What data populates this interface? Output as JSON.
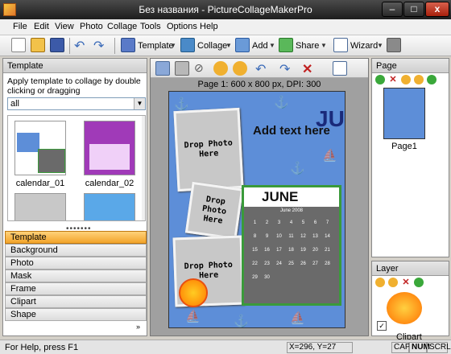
{
  "window": {
    "title": "Без названия - PictureCollageMakerPro"
  },
  "menu": [
    "File",
    "Edit",
    "View",
    "Photo",
    "Collage",
    "Tools",
    "Options",
    "Help"
  ],
  "toolbar": {
    "template": "Template",
    "collage": "Collage",
    "add": "Add",
    "share": "Share",
    "wizard": "Wizard"
  },
  "left": {
    "header": "Template",
    "description": "Apply template to collage by double clicking or dragging",
    "filter": "all",
    "thumbs": [
      "calendar_01",
      "calendar_02"
    ],
    "tabs": [
      "Template",
      "Background",
      "Photo",
      "Mask",
      "Frame",
      "Clipart",
      "Shape"
    ],
    "active_tab": "Template"
  },
  "center": {
    "pageinfo": "Page 1: 600 x 800 px, DPI: 300",
    "placeholder1": "Drop Photo Here",
    "placeholder2": "Drop Photo Here",
    "placeholder3": "Drop Photo Here",
    "addtext": "Add text here",
    "jun": "JUN",
    "cal_month": "JUNE",
    "cal_year": "June 2008"
  },
  "right": {
    "page_header": "Page",
    "page_label": "Page1",
    "layer_header": "Layer",
    "layer_item": "Clipart"
  },
  "status": {
    "help": "For Help, press F1",
    "coords": "X=296, Y=27",
    "cap": "CAP",
    "num": "NUM",
    "scrl": "SCRL"
  },
  "colors": {
    "accent_tab": "#f2a32a",
    "page_bg": "#5d8ed8",
    "calendar_border": "#3a9a3a"
  }
}
